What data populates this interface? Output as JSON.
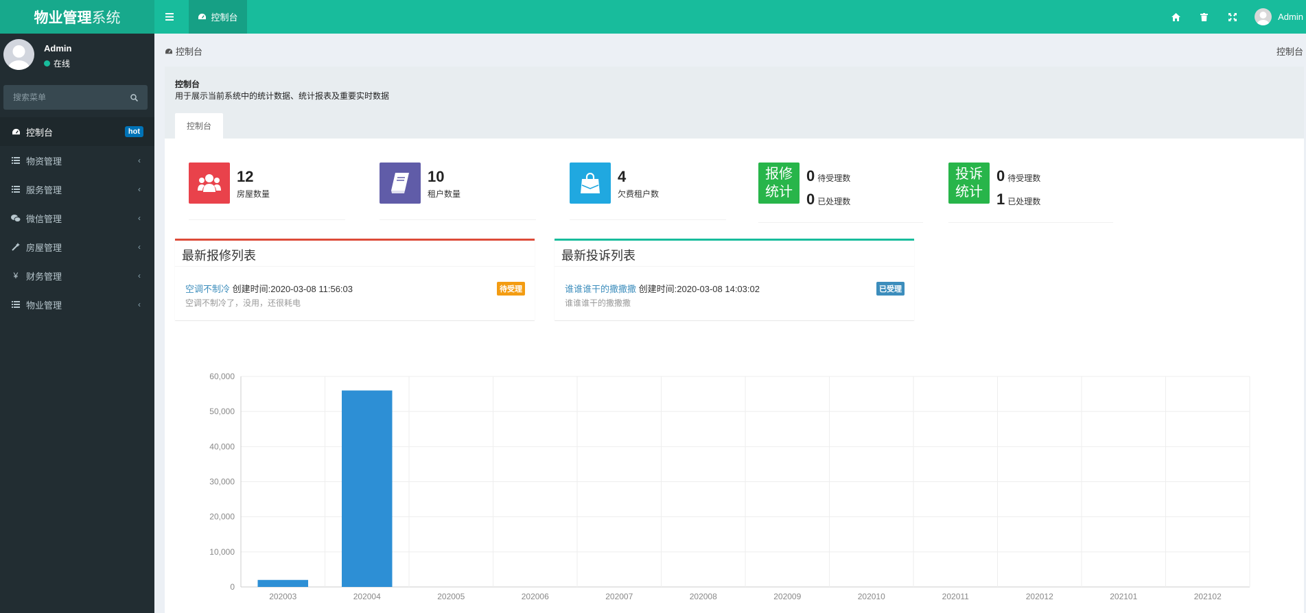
{
  "header": {
    "logo_bold": "物业管理",
    "logo_light": "系统",
    "tab_label": "控制台",
    "user_name": "Admin"
  },
  "sidebar": {
    "user_name": "Admin",
    "status": "在线",
    "search_placeholder": "搜索菜单",
    "items": [
      {
        "label": "控制台",
        "icon": "dashboard-icon",
        "badge": "hot",
        "active": true
      },
      {
        "label": "物资管理",
        "icon": "list-icon"
      },
      {
        "label": "服务管理",
        "icon": "list-icon"
      },
      {
        "label": "微信管理",
        "icon": "wechat-icon"
      },
      {
        "label": "房屋管理",
        "icon": "magic-wand-icon"
      },
      {
        "label": "财务管理",
        "icon": "yen-icon"
      },
      {
        "label": "物业管理",
        "icon": "list-icon"
      }
    ]
  },
  "breadcrumb": {
    "left": "控制台",
    "right": "控制台"
  },
  "panel": {
    "title": "控制台",
    "description": "用于展示当前系统中的统计数据、统计报表及重要实时数据",
    "tab": "控制台"
  },
  "stats": [
    {
      "value": "12",
      "label": "房屋数量",
      "color": "#e9424b",
      "icon": "users-icon"
    },
    {
      "value": "10",
      "label": "租户数量",
      "color": "#605ca8",
      "icon": "book-icon"
    },
    {
      "value": "4",
      "label": "欠费租户数",
      "color": "#20a8e0",
      "icon": "shopping-bag-icon"
    }
  ],
  "repair_stats": {
    "box_line1": "报修",
    "box_line2": "统计",
    "pending": "0",
    "pending_label": "待受理数",
    "done": "0",
    "done_label": "已处理数"
  },
  "complaint_stats": {
    "box_line1": "投诉",
    "box_line2": "统计",
    "pending": "0",
    "pending_label": "待受理数",
    "done": "1",
    "done_label": "已处理数"
  },
  "repair_list": {
    "title": "最新报修列表",
    "accent": "#dd4b39",
    "item": {
      "link": "空调不制冷",
      "created": "创建时间:2020-03-08 11:56:03",
      "desc": "空调不制冷了，没用，还很耗电",
      "badge": "待受理",
      "badge_color": "#f39c12"
    }
  },
  "complaint_list": {
    "title": "最新投诉列表",
    "accent": "#18bc9c",
    "item": {
      "link": "谁谁谁干的撒撒撒",
      "created": "创建时间:2020-03-08 14:03:02",
      "desc": "谁谁谁干的撒撒撒",
      "badge": "已受理",
      "badge_color": "#3c8dbc"
    }
  },
  "chart_data": {
    "type": "bar",
    "categories": [
      "202003",
      "202004",
      "202005",
      "202006",
      "202007",
      "202008",
      "202009",
      "202010",
      "202011",
      "202012",
      "202101",
      "202102"
    ],
    "values": [
      2000,
      56000,
      0,
      0,
      0,
      0,
      0,
      0,
      0,
      0,
      0,
      0
    ],
    "ylim": [
      0,
      60000
    ],
    "yticks": [
      0,
      10000,
      20000,
      30000,
      40000,
      50000,
      60000
    ],
    "ytick_labels": [
      "0",
      "10,000",
      "20,000",
      "30,000",
      "40,000",
      "50,000",
      "60,000"
    ],
    "bar_color": "#2d8fd5",
    "grid": true
  }
}
